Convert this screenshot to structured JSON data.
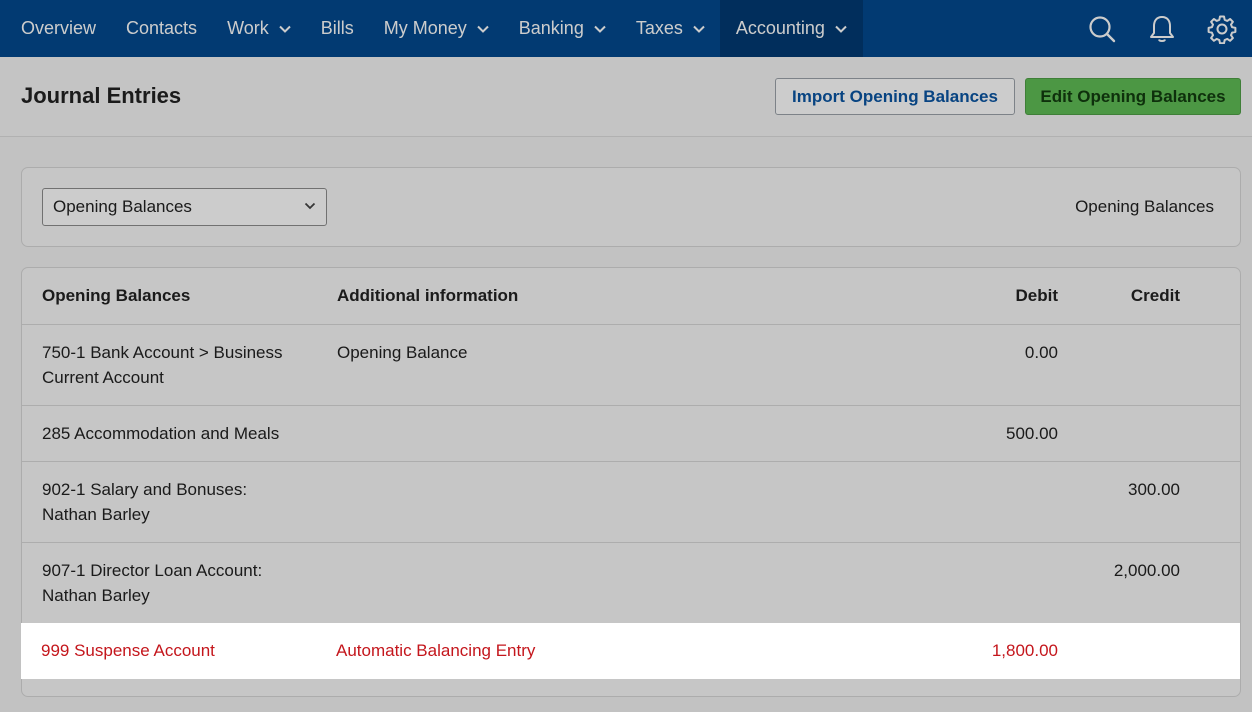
{
  "nav": {
    "items": [
      {
        "label": "Overview",
        "dropdown": false
      },
      {
        "label": "Contacts",
        "dropdown": false
      },
      {
        "label": "Work",
        "dropdown": true
      },
      {
        "label": "Bills",
        "dropdown": false
      },
      {
        "label": "My Money",
        "dropdown": true
      },
      {
        "label": "Banking",
        "dropdown": true
      },
      {
        "label": "Taxes",
        "dropdown": true
      },
      {
        "label": "Accounting",
        "dropdown": true,
        "active": true
      }
    ],
    "icons": [
      "search-icon",
      "bell-icon",
      "gear-icon"
    ]
  },
  "header": {
    "title": "Journal Entries",
    "import_label": "Import Opening Balances",
    "edit_label": "Edit Opening Balances"
  },
  "filter": {
    "selected": "Opening Balances",
    "right_label": "Opening Balances"
  },
  "table": {
    "columns": [
      "Opening Balances",
      "Additional information",
      "Debit",
      "Credit"
    ],
    "rows": [
      {
        "account": "750-1 Bank Account > Business Current Account",
        "info": "Opening Balance",
        "debit": "0.00",
        "credit": ""
      },
      {
        "account": "285 Accommodation and Meals",
        "info": "",
        "debit": "500.00",
        "credit": ""
      },
      {
        "account": "902-1 Salary and Bonuses: Nathan Barley",
        "info": "",
        "debit": "",
        "credit": "300.00"
      },
      {
        "account": "907-1 Director Loan Account: Nathan Barley",
        "info": "",
        "debit": "",
        "credit": "2,000.00"
      },
      {
        "account": "999 Suspense Account",
        "info": "Automatic Balancing Entry",
        "debit": "1,800.00",
        "credit": "",
        "highlight": true
      }
    ]
  },
  "colors": {
    "nav_bg": "#03498f",
    "nav_active": "#023a73",
    "edit_button": "#60bd55",
    "highlight_text": "#c4161c"
  }
}
